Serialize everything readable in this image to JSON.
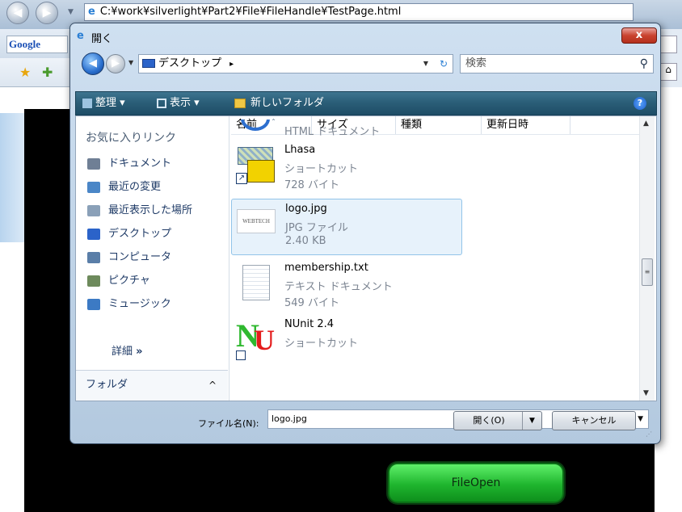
{
  "browser": {
    "url": "C:¥work¥silverlight¥Part2¥File¥FileHandle¥TestPage.html",
    "google_label": "Google"
  },
  "page": {
    "file_open_button": "FileOpen"
  },
  "dialog": {
    "title": "開く",
    "close_glyph": "x",
    "location": "デスクトップ",
    "location_sep": "▸",
    "search_placeholder": "検索",
    "commands": {
      "organize": "整理 ▾",
      "view": "表示 ▾",
      "new_folder": "新しいフォルダ",
      "help": "?"
    },
    "sidebar": {
      "header": "お気に入りリンク",
      "items": [
        {
          "label": "ドキュメント",
          "icon": "documents-icon",
          "color": "#6f7f95"
        },
        {
          "label": "最近の変更",
          "icon": "recent-changes-icon",
          "color": "#4a86c7"
        },
        {
          "label": "最近表示した場所",
          "icon": "recent-places-icon",
          "color": "#8aa0b8"
        },
        {
          "label": "デスクトップ",
          "icon": "desktop-icon",
          "color": "#2b63c9"
        },
        {
          "label": "コンピュータ",
          "icon": "computer-icon",
          "color": "#5a7ea8"
        },
        {
          "label": "ピクチャ",
          "icon": "pictures-icon",
          "color": "#6d8a5c"
        },
        {
          "label": "ミュージック",
          "icon": "music-icon",
          "color": "#3c7ac4"
        }
      ],
      "more": "詳細",
      "more_chevron": "»",
      "folders": "フォルダ",
      "folders_toggle": "^"
    },
    "columns": [
      "名前",
      "サイズ",
      "種類",
      "更新日時"
    ],
    "files": [
      {
        "name": "",
        "type": "HTML ドキュメント",
        "size": "",
        "icon": "html-icon",
        "selected": false
      },
      {
        "name": "Lhasa",
        "type": "ショートカット",
        "size": "728 バイト",
        "icon": "lhasa-shortcut-icon",
        "selected": false
      },
      {
        "name": "logo.jpg",
        "type": "JPG ファイル",
        "size": "2.40 KB",
        "icon": "jpg-thumbnail-icon",
        "thumb_text": "WEBTECH",
        "selected": true
      },
      {
        "name": "membership.txt",
        "type": "テキスト ドキュメント",
        "size": "549 バイト",
        "icon": "text-file-icon",
        "selected": false
      },
      {
        "name": "NUnit 2.4",
        "type": "ショートカット",
        "size": "",
        "icon": "nunit-shortcut-icon",
        "selected": false
      }
    ],
    "filename_label": "ファイル名(N):",
    "filename_value": "logo.jpg",
    "open_button": "開く(O)",
    "cancel_button": "キャンセル"
  }
}
